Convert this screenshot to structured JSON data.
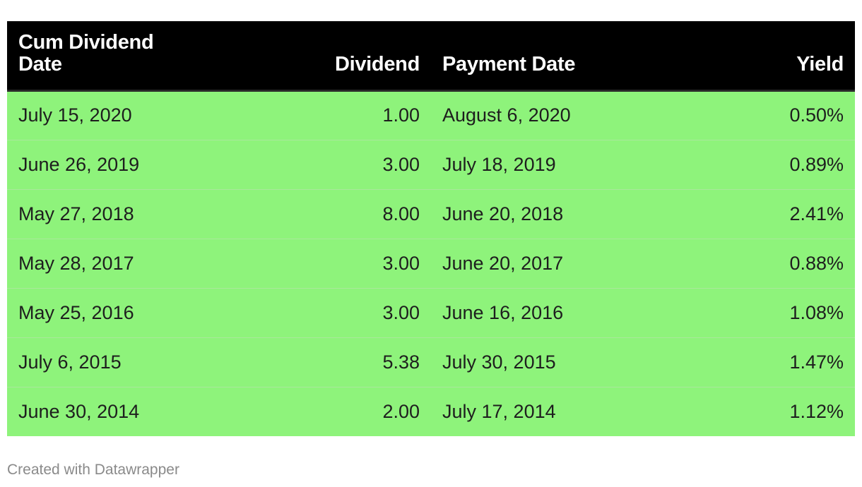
{
  "chart_data": {
    "type": "table",
    "columns": [
      "Cum Dividend Date",
      "Dividend",
      "Payment Date",
      "Yield"
    ],
    "rows": [
      [
        "July 15, 2020",
        "1.00",
        "August 6, 2020",
        "0.50%"
      ],
      [
        "June 26, 2019",
        "3.00",
        "July 18, 2019",
        "0.89%"
      ],
      [
        "May 27, 2018",
        "8.00",
        "June 20, 2018",
        "2.41%"
      ],
      [
        "May 28, 2017",
        "3.00",
        "June 20, 2017",
        "0.88%"
      ],
      [
        "May 25, 2016",
        "3.00",
        "June 16, 2016",
        "1.08%"
      ],
      [
        "July 6, 2015",
        "5.38",
        "July 30, 2015",
        "1.47%"
      ],
      [
        "June 30, 2014",
        "2.00",
        "July 17, 2014",
        "1.12%"
      ]
    ]
  },
  "header": {
    "cum_dividend_line1": "Cum Dividend",
    "cum_dividend_line2": "Date",
    "dividend": "Dividend",
    "payment_date": "Payment Date",
    "yield": "Yield"
  },
  "colors": {
    "header_bg": "#000000",
    "header_text": "#ffffff",
    "row_bg": "#8ef37b",
    "row_text": "#1e1e1e"
  },
  "footer": {
    "credit": "Created with Datawrapper"
  }
}
